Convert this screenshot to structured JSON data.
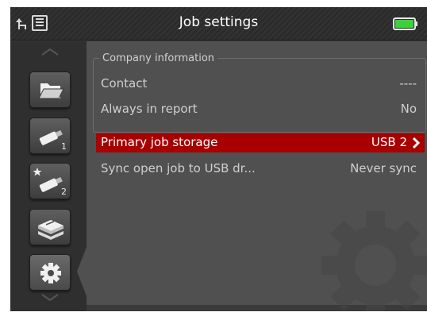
{
  "header": {
    "title": "Job settings",
    "icons": [
      "back-icon",
      "list-icon",
      "battery-icon"
    ],
    "battery_color": "#3cd13c"
  },
  "rail": {
    "buttons": [
      {
        "icon": "folder-icon",
        "num": ""
      },
      {
        "icon": "usb-drive-icon",
        "num": "1"
      },
      {
        "icon": "usb-drive-starred-icon",
        "num": "2"
      },
      {
        "icon": "storage-stack-icon",
        "num": ""
      },
      {
        "icon": "gear-icon",
        "num": ""
      }
    ]
  },
  "company_info": {
    "legend": "Company information",
    "rows": [
      {
        "label": "Contact",
        "value": "----"
      },
      {
        "label": "Always in report",
        "value": "No"
      }
    ]
  },
  "settings": [
    {
      "label": "Primary job storage",
      "value": "USB 2",
      "selected": true
    },
    {
      "label": "Sync open job to USB dr...",
      "value": "Never sync",
      "selected": false
    }
  ],
  "colors": {
    "selection": "#a80000",
    "panel": "#505050",
    "rail": "#2f2f2f"
  }
}
